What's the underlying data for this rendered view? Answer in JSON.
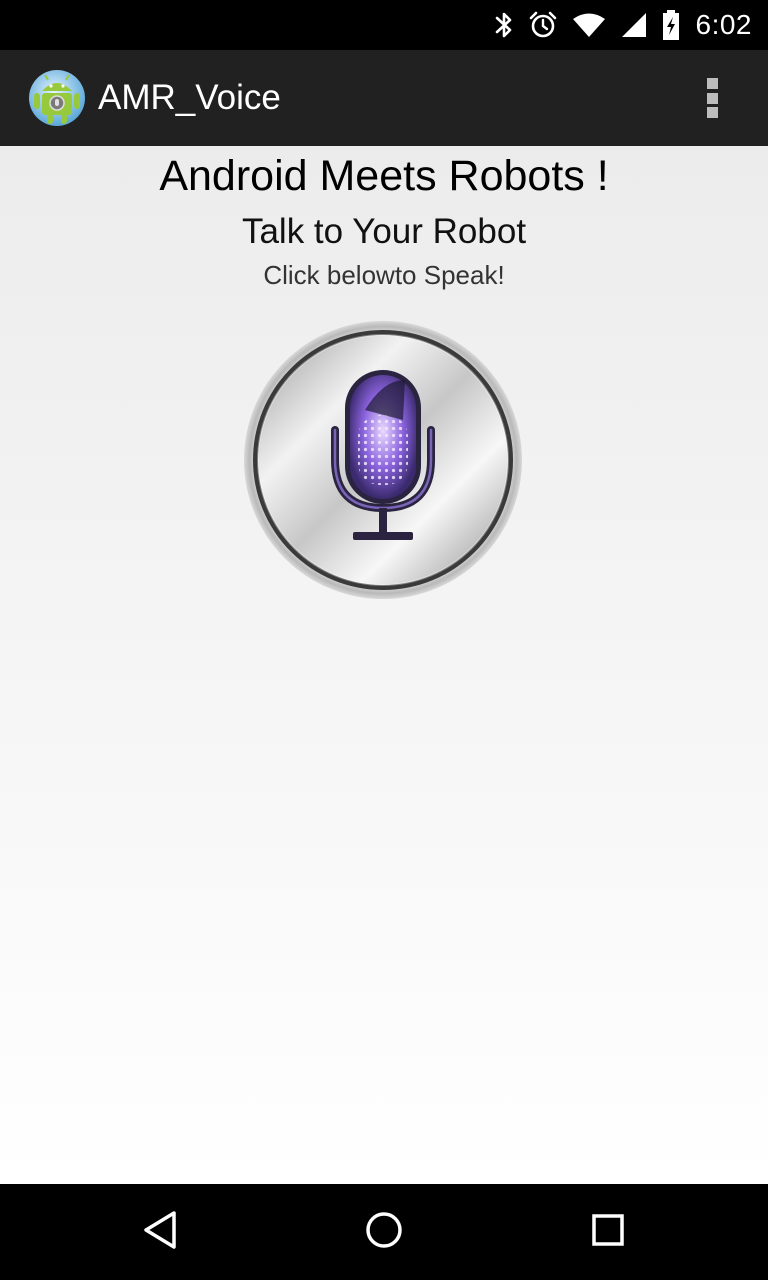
{
  "status_bar": {
    "time": "6:02",
    "icons": [
      "bluetooth-icon",
      "alarm-icon",
      "wifi-icon",
      "cell-signal-icon",
      "battery-charging-icon"
    ]
  },
  "action_bar": {
    "title": "AMR_Voice",
    "app_icon": "android-robot-app-icon",
    "overflow_icon": "overflow-menu-icon"
  },
  "main": {
    "heading": "Android Meets Robots !",
    "subheading": "Talk to Your Robot",
    "caption": "Click belowto Speak!",
    "mic_icon": "microphone-icon"
  },
  "nav_bar": {
    "buttons": [
      "back-icon",
      "home-icon",
      "recents-icon"
    ]
  },
  "colors": {
    "status_bar": "#000000",
    "action_bar": "#212121",
    "nav_bar": "#000000",
    "mic_accent": "#7a5ad8"
  }
}
